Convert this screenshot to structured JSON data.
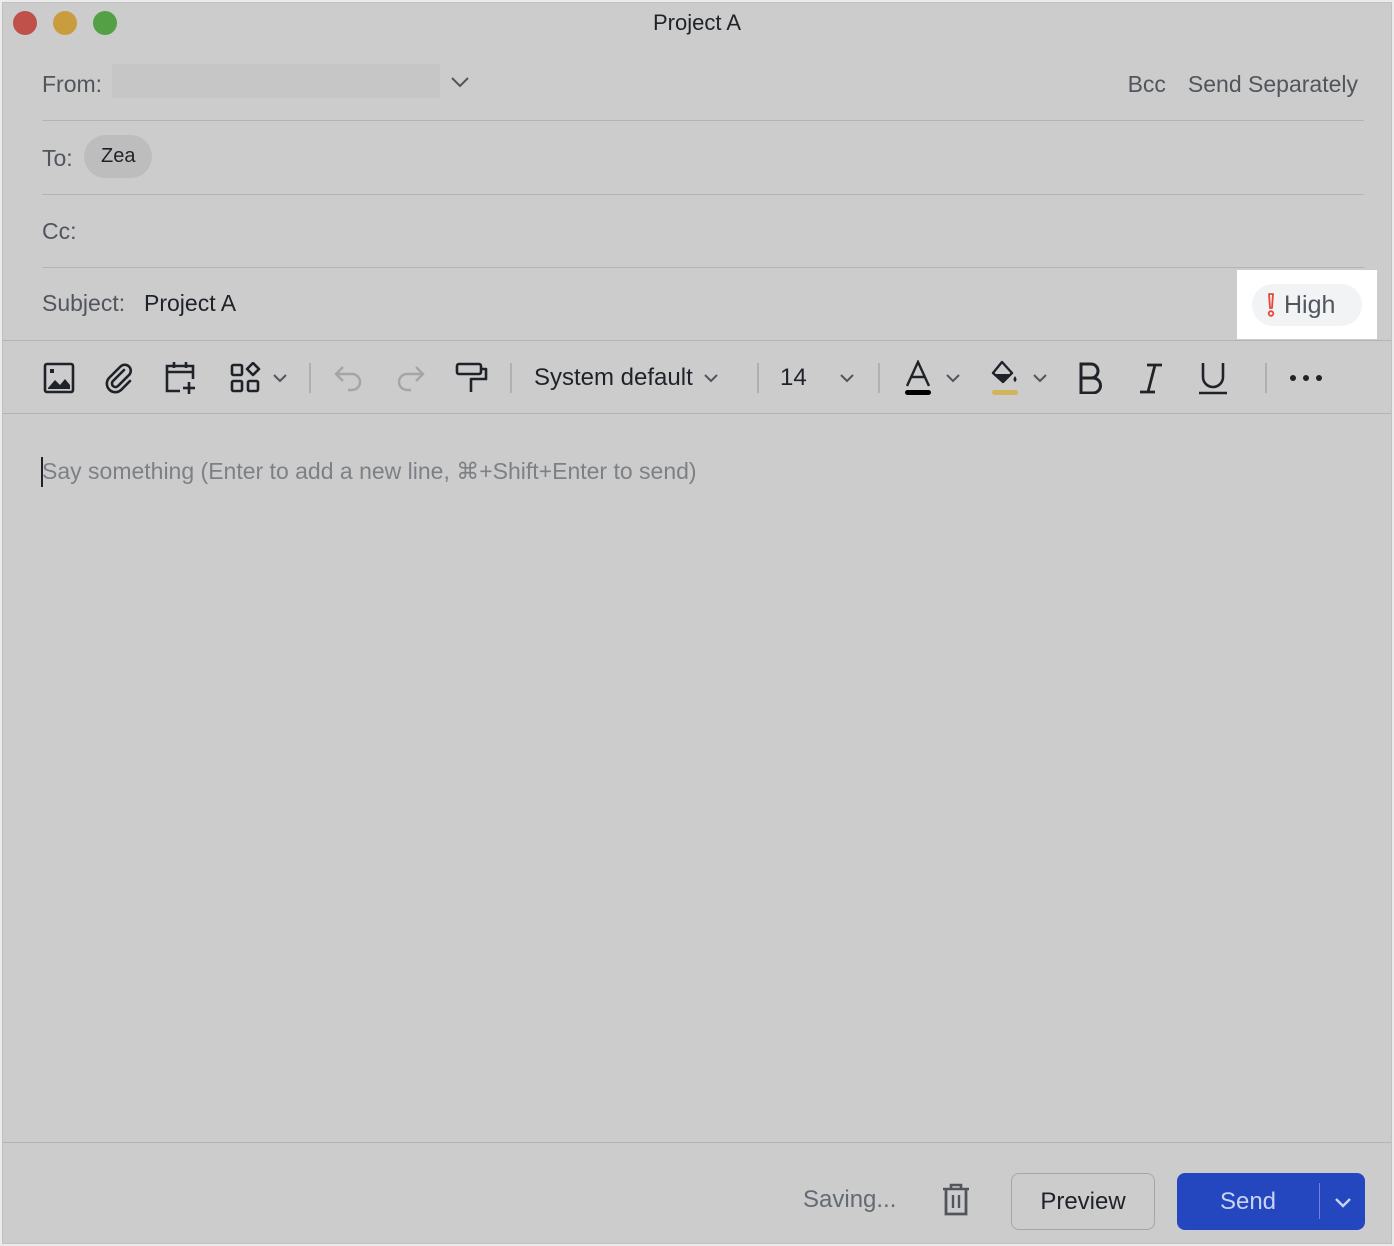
{
  "window": {
    "title": "Project A",
    "controls": [
      "close",
      "minimize",
      "maximize"
    ]
  },
  "header": {
    "from_label": "From:",
    "from_value": "",
    "bcc_label": "Bcc",
    "send_separately_label": "Send Separately",
    "to_label": "To:",
    "to_recipients": [
      {
        "name": "Zea"
      }
    ],
    "cc_label": "Cc:",
    "subject_label": "Subject:",
    "subject_value": "Project A",
    "priority": {
      "label": "High",
      "icon": "exclamation-icon",
      "color": "#e5483d"
    }
  },
  "toolbar": {
    "items": [
      {
        "name": "insert-image",
        "icon": "image-icon"
      },
      {
        "name": "attach-file",
        "icon": "paperclip-icon"
      },
      {
        "name": "insert-calendar",
        "icon": "calendar-plus-icon"
      },
      {
        "name": "more-inserts",
        "icon": "apps-icon"
      },
      {
        "name": "undo",
        "icon": "undo-icon"
      },
      {
        "name": "redo",
        "icon": "redo-icon"
      },
      {
        "name": "format-painter",
        "icon": "paint-roller-icon"
      }
    ],
    "font_family": "System default",
    "font_size": "14",
    "text_color": "#000000",
    "highlight_color": "#d4b45a",
    "bold_label": "B",
    "italic_label": "I",
    "underline_label": "U"
  },
  "editor": {
    "placeholder": "Say something (Enter to add a new line, ⌘+Shift+Enter to send)",
    "value": ""
  },
  "footer": {
    "status": "Saving...",
    "preview_label": "Preview",
    "send_label": "Send",
    "send_color": "#2447bf"
  }
}
